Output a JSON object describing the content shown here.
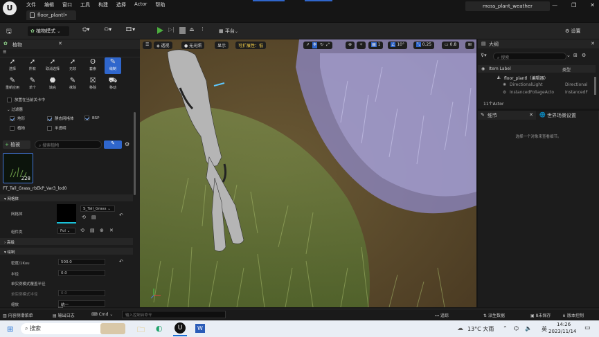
{
  "menubar": {
    "items": [
      "文件",
      "编辑",
      "窗口",
      "工具",
      "构建",
      "选择",
      "Actor",
      "帮助"
    ],
    "doc_tab": "floor_plantl•",
    "project_name": "moss_plant_weather"
  },
  "toolbar": {
    "mode_label": "植物模式",
    "platform_label": "平台",
    "settings_label": "设置"
  },
  "foliage_panel": {
    "title": "植物",
    "modes": [
      {
        "label": "选择",
        "icon": "select-arrow-icon"
      },
      {
        "label": "所有",
        "icon": "select-all-icon"
      },
      {
        "label": "取消选择",
        "icon": "deselect-icon"
      },
      {
        "label": "无效",
        "icon": "invalid-icon"
      },
      {
        "label": "套索",
        "icon": "lasso-icon"
      },
      {
        "label": "绘制",
        "icon": "paint-brush-icon"
      },
      {
        "label": "重新应用",
        "icon": "reapply-icon"
      },
      {
        "label": "单个",
        "icon": "single-icon"
      },
      {
        "label": "填充",
        "icon": "fill-icon"
      },
      {
        "label": "抹除",
        "icon": "erase-icon"
      },
      {
        "label": "移除",
        "icon": "remove-icon"
      },
      {
        "label": "移动",
        "icon": "move-icon"
      }
    ],
    "place_in_current_level": "放置在当前关卡中",
    "filter_title": "过滤器",
    "filters": [
      {
        "label": "地形",
        "checked": true
      },
      {
        "label": "静态网格体",
        "checked": true
      },
      {
        "label": "BSP",
        "checked": true
      },
      {
        "label": "植物",
        "checked": false
      },
      {
        "label": "半透明",
        "checked": false
      }
    ],
    "add_foliage_label": "植被",
    "search_placeholder": "搜索植物",
    "foliage_item": {
      "name": "FT_Tall_Grass_rbEkP_Var3_lod0",
      "count": "228"
    },
    "mesh_section": "网格体",
    "mesh_label": "网格体",
    "mesh_value": "S_Tall_Grass",
    "component_label": "组件类",
    "component_value": "Fol",
    "sections": [
      "高级",
      "绘制"
    ],
    "density_label": "密度/1Kuu",
    "density_value": "500.0",
    "radius_label": "半径",
    "radius_value": "0.0",
    "single_instance_radius_label": "单实例模式覆盖半径",
    "single_instance_label": "单实例模式半径",
    "single_instance_value": "0.0",
    "scaling_label": "缩放",
    "scaling_value": "统一"
  },
  "viewport": {
    "perspective_label": "透视",
    "lit_label": "无光照",
    "show_label": "显示",
    "scalability_label": "可扩展性：低",
    "grid_value": "1",
    "rotation_snap": "10°",
    "scale_snap": "0.25",
    "camera_speed": "0.8"
  },
  "outliner": {
    "title": "大纲",
    "search_placeholder": "搜索",
    "col_item_label": "Item Label",
    "col_type": "类型",
    "rows": [
      {
        "label": "floor_plantl（编辑器）",
        "type": ""
      },
      {
        "label": "DirectionalLight",
        "type": "Directional"
      },
      {
        "label": "InstancedFoliageActo",
        "type": "InstancedF"
      }
    ],
    "count": "11个Actor"
  },
  "details": {
    "tab_details": "细节",
    "tab_world_settings": "世界场景设置",
    "empty_message": "选择一个对象来查看细节。"
  },
  "statusbar": {
    "content_drawer": "内容侧滑菜单",
    "output_log": "输出日志",
    "cmd_label": "Cmd",
    "console_placeholder": "输入控制台命令",
    "trace": "追踪",
    "derived_data": "派生数据",
    "unsaved": "8未保存",
    "source_control": "版本控制"
  },
  "taskbar": {
    "search_label": "搜索",
    "weather": "13°C 大雨",
    "ime": "英",
    "time": "14:26",
    "date": "2023/11/14"
  }
}
